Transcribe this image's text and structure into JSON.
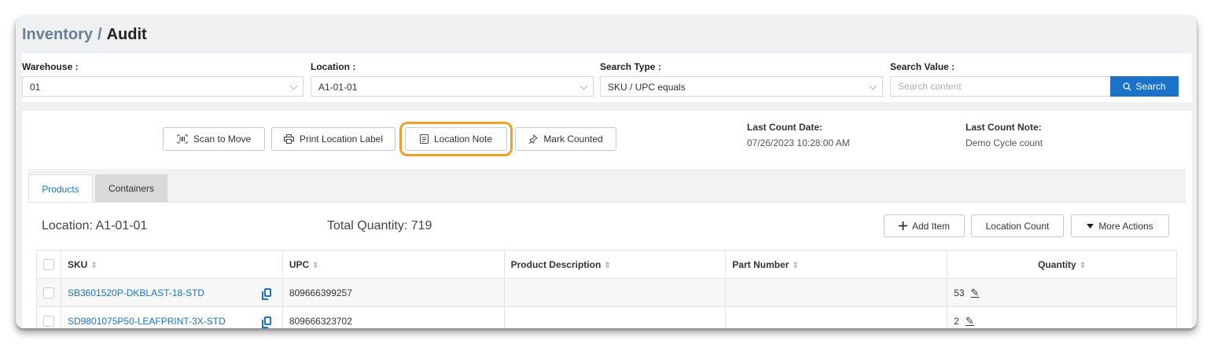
{
  "breadcrumb": {
    "parent": "Inventory",
    "separator": "/",
    "current": "Audit"
  },
  "filters": {
    "warehouse": {
      "label": "Warehouse :",
      "value": "01"
    },
    "location": {
      "label": "Location :",
      "value": "A1-01-01"
    },
    "search_type": {
      "label": "Search Type :",
      "value": "SKU / UPC equals"
    },
    "search_value": {
      "label": "Search Value :",
      "placeholder": "Search content",
      "button_label": "Search",
      "icon": "search-icon"
    }
  },
  "toolbar": {
    "scan_to_move": {
      "label": "Scan to Move",
      "icon": "barcode-scan-icon"
    },
    "print_location_label": {
      "label": "Print Location Label",
      "icon": "printer-icon"
    },
    "location_note": {
      "label": "Location Note",
      "icon": "note-icon"
    },
    "mark_counted": {
      "label": "Mark Counted",
      "icon": "pin-icon"
    },
    "highlight_color": "#f0a024"
  },
  "last_count": {
    "date_label": "Last Count Date:",
    "date_value": "07/26/2023 10:28:00 AM",
    "note_label": "Last Count Note:",
    "note_value": "Demo Cycle count"
  },
  "tabs": [
    {
      "label": "Products",
      "active": true
    },
    {
      "label": "Containers",
      "active": false
    }
  ],
  "products": {
    "location_label": "Location: A1-01-01",
    "total_quantity_label": "Total Quantity: 719",
    "actions": {
      "add_item": "Add Item",
      "location_count": "Location Count",
      "more_actions": "More Actions"
    },
    "columns": [
      "SKU",
      "UPC",
      "Product Description",
      "Part Number",
      "Quantity"
    ],
    "rows": [
      {
        "sku": "SB3601520P-DKBLAST-18-STD",
        "upc": "809666399257",
        "description": "",
        "part_number": "",
        "quantity": "53"
      },
      {
        "sku": "SD9801075P50-LEAFPRINT-3X-STD",
        "upc": "809666323702",
        "description": "",
        "part_number": "",
        "quantity": "2"
      }
    ]
  },
  "colors": {
    "accent": "#1a73c8",
    "link": "#1a73c8",
    "highlight": "#f0a024"
  }
}
